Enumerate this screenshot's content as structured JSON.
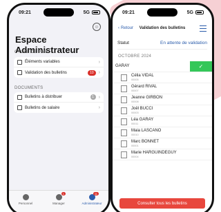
{
  "phone1": {
    "time": "09:21",
    "network": "5G",
    "title": "Espace Administrateur",
    "sections": [
      {
        "label": "CYCLE DE PAIE",
        "items": [
          {
            "label": "Éléments variables",
            "badge": ""
          },
          {
            "label": "Validation des bulletins",
            "badge": "10"
          }
        ]
      },
      {
        "label": "DOCUMENTS",
        "items": [
          {
            "label": "Bulletins à distribuer",
            "badge": "1"
          },
          {
            "label": "Bulletins de salaire",
            "badge": ""
          }
        ]
      }
    ],
    "tabs": [
      {
        "label": "Personnel",
        "badge": ""
      },
      {
        "label": "Manager",
        "badge": "1"
      },
      {
        "label": "Administrateur",
        "badge": "11"
      }
    ]
  },
  "phone2": {
    "time": "09:21",
    "network": "5G",
    "back_label": "Retour",
    "title": "Validation des bulletins",
    "statut_label": "Statut",
    "statut_value": "En attente de validation",
    "month": "OCTOBRE 2024",
    "employees": [
      {
        "name": "GARAY",
        "id": "",
        "swiped": true
      },
      {
        "name": "Célia VIDAL",
        "id": "00005"
      },
      {
        "name": "Gérard RIVAL",
        "id": "00007"
      },
      {
        "name": "Jeanne GIRBON",
        "id": "00008"
      },
      {
        "name": "Joël BUCCI",
        "id": "00003"
      },
      {
        "name": "Léa GARAY",
        "id": "00011"
      },
      {
        "name": "Maia LASCANO",
        "id": "00010"
      },
      {
        "name": "Marc BONNET",
        "id": "00001"
      },
      {
        "name": "Marie HARGUINDEGUY",
        "id": "00004"
      }
    ],
    "consult_button": "Consulter tous les bulletins"
  },
  "colors": {
    "accent": "#2b5cab",
    "danger": "#d9302a",
    "success": "#34c759"
  }
}
